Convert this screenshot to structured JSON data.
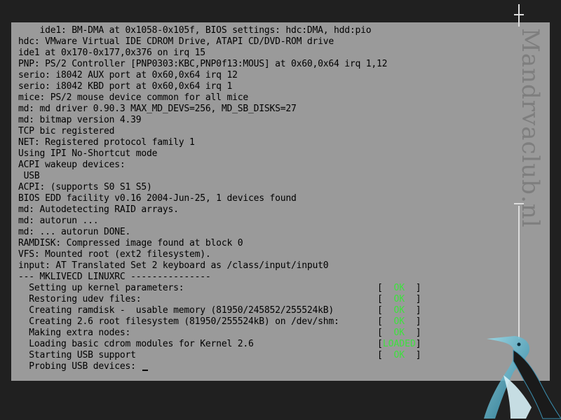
{
  "console": {
    "lines": [
      "    ide1: BM-DMA at 0x1058-0x105f, BIOS settings: hdc:DMA, hdd:pio",
      "hdc: VMware Virtual IDE CDROM Drive, ATAPI CD/DVD-ROM drive",
      "ide1 at 0x170-0x177,0x376 on irq 15",
      "PNP: PS/2 Controller [PNP0303:KBC,PNP0f13:MOUS] at 0x60,0x64 irq 1,12",
      "serio: i8042 AUX port at 0x60,0x64 irq 12",
      "serio: i8042 KBD port at 0x60,0x64 irq 1",
      "mice: PS/2 mouse device common for all mice",
      "md: md driver 0.90.3 MAX_MD_DEVS=256, MD_SB_DISKS=27",
      "md: bitmap version 4.39",
      "TCP bic registered",
      "NET: Registered protocol family 1",
      "Using IPI No-Shortcut mode",
      "ACPI wakeup devices:",
      " USB",
      "ACPI: (supports S0 S1 S5)",
      "BIOS EDD facility v0.16 2004-Jun-25, 1 devices found",
      "md: Autodetecting RAID arrays.",
      "md: autorun ...",
      "md: ... autorun DONE.",
      "RAMDISK: Compressed image found at block 0",
      "VFS: Mounted root (ext2 filesystem).",
      "input: AT Translated Set 2 keyboard as /class/input/input0",
      "--- MKLIVECD LINUXRC ---------------"
    ],
    "tasks": [
      {
        "text": "  Setting up kernel parameters:",
        "status": "OK"
      },
      {
        "text": "  Restoring udev files:",
        "status": "OK"
      },
      {
        "text": "  Creating ramdisk -  usable memory (81950/245852/255524kB)",
        "status": "OK"
      },
      {
        "text": "  Creating 2.6 root filesystem (81950/255524kB) on /dev/shm:",
        "status": "OK"
      },
      {
        "text": "  Making extra nodes:",
        "status": "OK"
      },
      {
        "text": "  Loading basic cdrom modules for Kernel 2.6",
        "status": "LOADED"
      },
      {
        "text": "  Starting USB support",
        "status": "OK"
      }
    ],
    "prompt": "  Probing USB devices: "
  },
  "watermark": "Mandrvaclub.nl",
  "colors": {
    "background": "#202020",
    "console_bg": "#9a9a9a",
    "text": "#000000",
    "status_ok": "#3ee03e"
  },
  "icons": {
    "logo": "penguin-logo"
  }
}
